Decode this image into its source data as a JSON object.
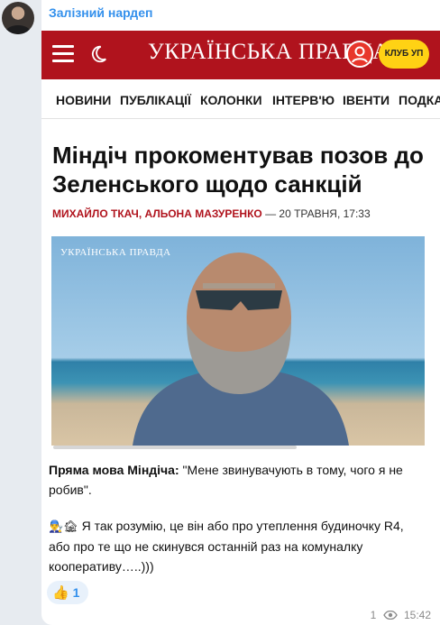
{
  "sender": {
    "name": "Залізний нардеп"
  },
  "embedded_screenshot": {
    "site": {
      "logo_text": "УКРАЇНСЬКА ПРАВДА",
      "club_button": "КЛУБ УП",
      "header_color": "#b0131d",
      "club_color": "#ffd214"
    },
    "nav": [
      "НОВИНИ",
      "ПУБЛІКАЦІЇ",
      "КОЛОНКИ",
      "ІНТЕРВ'Ю",
      "ІВЕНТИ",
      "ПОДКА"
    ],
    "headline": "Міндіч прокоментував позов до Зеленського щодо санкцій",
    "byline": {
      "authors": "МИХАЙЛО ТКАЧ, АЛЬОНА МАЗУРЕНКО",
      "rest": " — 20 ТРАВНЯ, 17:33"
    },
    "photo_watermark": "УКРАЇНСЬКА ПРАВДА"
  },
  "message": {
    "quote_label": "Пряма мова Міндіча:",
    "quote_text": " \"Мене звинувачують в тому, чого я не робив\".",
    "comment_emojis": "👨‍🔧🏚",
    "comment": " Я так розумію, це він або про утеплення будиночку R4, або про те що не скинувся останній раз на комуналку кооперативу…..)))"
  },
  "reaction": {
    "emoji": "👍",
    "count": "1"
  },
  "meta": {
    "views": "1",
    "time": "15:42"
  }
}
